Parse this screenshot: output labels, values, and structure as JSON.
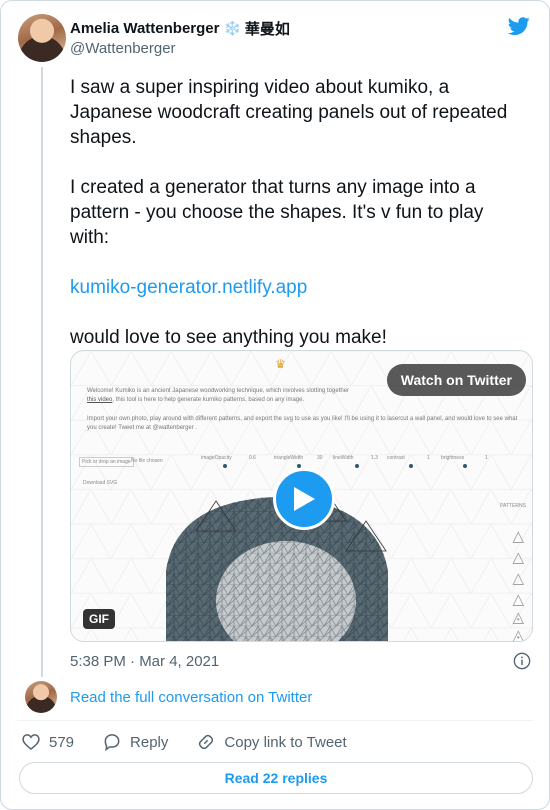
{
  "author": {
    "name": "Amelia Wattenberger",
    "name_emoji": "❄️",
    "name_cjk": "華曼如",
    "handle": "@Wattenberger"
  },
  "tweet": {
    "para1": "I saw a super inspiring video about kumiko, a Japanese woodcraft creating panels out of repeated shapes.",
    "para2": "I created a generator that turns any image into a pattern - you choose the shapes. It's v fun to play with:",
    "link": "kumiko-generator.netlify.app",
    "para3": "would love to see anything you make!"
  },
  "media": {
    "watch_label": "Watch on Twitter",
    "gif_label": "GIF",
    "intro_text": "Welcome! Kumiko is an ancient Japanese woodworking technique, which involves slotting together",
    "intro_link": "this video",
    "intro_text2": ", this tool is here to help generate kumiko patterns, based on any image.",
    "import_text": "Import your own photo, play around with different patterns, and export the svg to use as you like! I'll be using it to lasercut a wall panel, and would love to see what you create! Tweet me at @wattenberger .",
    "pick_button": "Pick or drop an image",
    "no_file": "No file chosen",
    "download": "Download SVG",
    "patterns_label": "PATTERNS",
    "controls": [
      {
        "label": "imageOpacity",
        "value": "0.6"
      },
      {
        "label": "triangleWidth",
        "value": "30"
      },
      {
        "label": "lineWidth",
        "value": "1.3"
      },
      {
        "label": "contrast",
        "value": "1"
      },
      {
        "label": "brightness",
        "value": "1"
      }
    ]
  },
  "timestamp": "5:38 PM · Mar 4, 2021",
  "conversation_link": "Read the full conversation on Twitter",
  "actions": {
    "likes": "579",
    "reply": "Reply",
    "copy": "Copy link to Tweet"
  },
  "read_replies": "Read 22 replies",
  "colors": {
    "accent": "#1d9bf0",
    "muted": "#536471",
    "text": "#0f1419",
    "border": "#cfd9de"
  },
  "icons": [
    "twitter-bird-icon",
    "info-icon",
    "heart-icon",
    "reply-icon",
    "link-icon",
    "play-icon",
    "crown-icon"
  ]
}
